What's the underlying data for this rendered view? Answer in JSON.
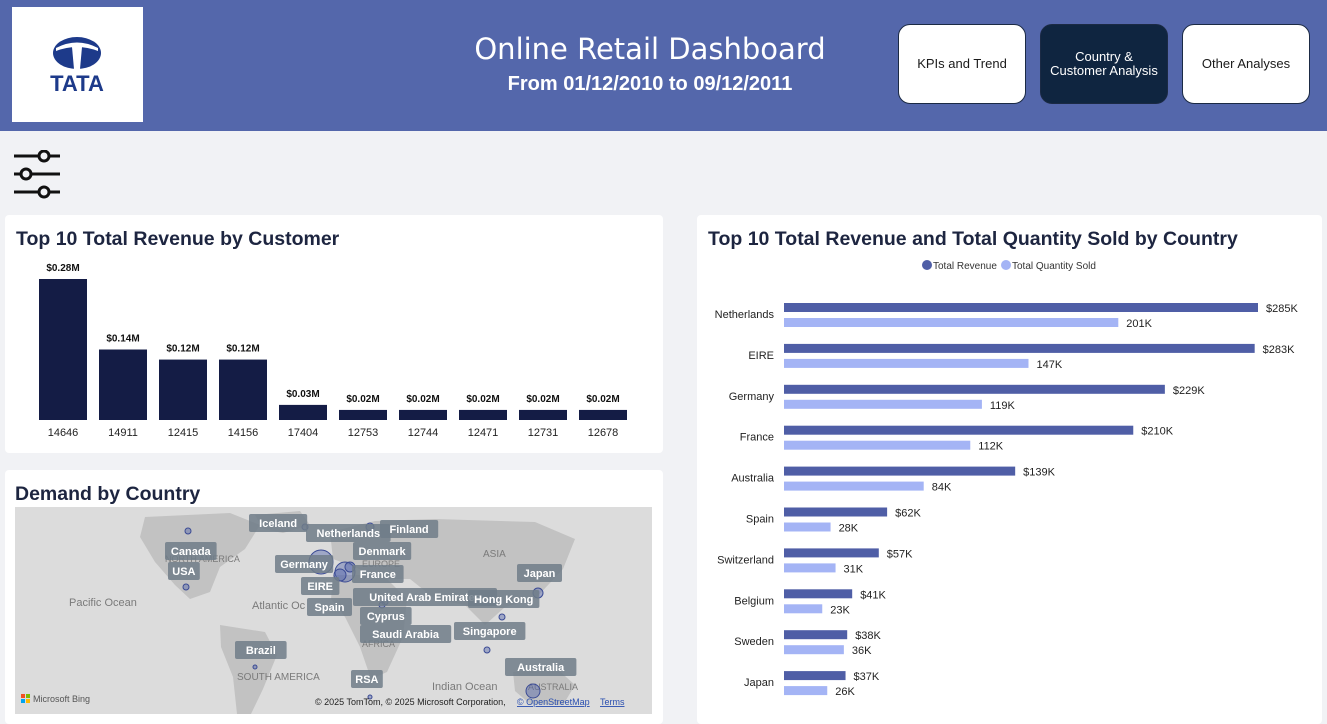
{
  "header": {
    "logo_text": "TATA",
    "title": "Online Retail Dashboard",
    "subtitle": "From 01/12/2010 to 09/12/2011",
    "nav": [
      {
        "label": "KPIs and Trend",
        "active": false
      },
      {
        "label": "Country & Customer Analysis",
        "active": true
      },
      {
        "label": "Other Analyses",
        "active": false
      }
    ],
    "colors": {
      "header_bg": "#5467ab",
      "active_nav": "#0f2540"
    }
  },
  "filter": {
    "icon": "sliders-icon"
  },
  "customer_chart": {
    "title": "Top 10 Total Revenue by Customer",
    "chart_data": {
      "type": "bar",
      "categories": [
        "14646",
        "14911",
        "12415",
        "14156",
        "17404",
        "12753",
        "12744",
        "12471",
        "12731",
        "12678"
      ],
      "values": [
        0.28,
        0.14,
        0.12,
        0.12,
        0.03,
        0.02,
        0.02,
        0.02,
        0.02,
        0.02
      ],
      "value_labels": [
        "$0.28M",
        "$0.14M",
        "$0.12M",
        "$0.12M",
        "$0.03M",
        "$0.02M",
        "$0.02M",
        "$0.02M",
        "$0.02M",
        "$0.02M"
      ],
      "unit": "$M",
      "color": "#141c45"
    }
  },
  "country_chart": {
    "title": "Top 10 Total Revenue and Total Quantity Sold by Country",
    "chart_data": {
      "type": "bar",
      "orientation": "horizontal",
      "categories": [
        "Netherlands",
        "EIRE",
        "Germany",
        "France",
        "Australia",
        "Spain",
        "Switzerland",
        "Belgium",
        "Sweden",
        "Japan"
      ],
      "series": [
        {
          "name": "Total Revenue",
          "color": "#4f5ea6",
          "values": [
            285,
            283,
            229,
            210,
            139,
            62,
            57,
            41,
            38,
            37
          ],
          "labels": [
            "$285K",
            "$283K",
            "$229K",
            "$210K",
            "$139K",
            "$62K",
            "$57K",
            "$41K",
            "$38K",
            "$37K"
          ]
        },
        {
          "name": "Total Quantity Sold",
          "color": "#a4b4f5",
          "values": [
            201,
            147,
            119,
            112,
            84,
            28,
            31,
            23,
            36,
            26
          ],
          "labels": [
            "201K",
            "147K",
            "119K",
            "112K",
            "84K",
            "28K",
            "31K",
            "23K",
            "36K",
            "26K"
          ]
        }
      ],
      "legend": "top-center"
    }
  },
  "map_card": {
    "title": "Demand by Country",
    "geo_labels": [
      "NORTH AMERICA",
      "SOUTH AMERICA",
      "EUROPE",
      "AFRICA",
      "ASIA",
      "AUSTRALIA",
      "Pacific Ocean",
      "Atlantic Oc",
      "Indian Ocean"
    ],
    "country_labels": [
      "Iceland",
      "Netherlands",
      "Finland",
      "Denmark",
      "Canada",
      "USA",
      "Germany",
      "France",
      "EIRE",
      "Spain",
      "United Arab Emirates",
      "Hong Kong",
      "Japan",
      "Cyprus",
      "Saudi Arabia",
      "Singapore",
      "Brazil",
      "Australia",
      "RSA"
    ],
    "bing_logo": "Microsoft Bing",
    "copyright": "© 2025 TomTom, © 2025 Microsoft Corporation,",
    "osm_link": "© OpenStreetMap",
    "terms": "Terms"
  }
}
